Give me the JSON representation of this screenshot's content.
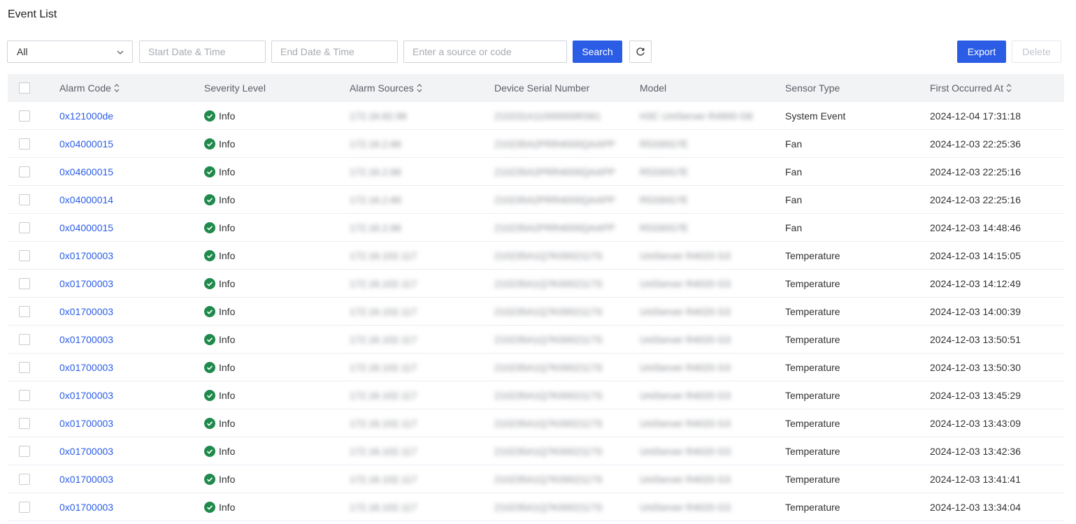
{
  "page": {
    "title": "Event List"
  },
  "toolbar": {
    "select_value": "All",
    "start_placeholder": "Start Date & Time",
    "end_placeholder": "End Date & Time",
    "search_placeholder": "Enter a source or code",
    "search_label": "Search",
    "export_label": "Export",
    "delete_label": "Delete"
  },
  "colors": {
    "accent": "#2b5ce6",
    "info_green": "#1f8a4c"
  },
  "table": {
    "headers": {
      "alarm_code": "Alarm Code",
      "severity": "Severity Level",
      "sources": "Alarm Sources",
      "serial": "Device Serial Number",
      "model": "Model",
      "sensor": "Sensor Type",
      "first": "First Occurred At"
    },
    "rows": [
      {
        "code": "0x121000de",
        "severity": "Info",
        "source": "172.16.62.96",
        "serial": "210231A11000000RS61",
        "model": "H3C UniServer R4900 G6",
        "sensor": "System Event",
        "time": "2024-12-04 17:31:18"
      },
      {
        "code": "0x04000015",
        "severity": "Info",
        "source": "172.16.2.66",
        "serial": "210235A2PRR4000QAAPP",
        "model": "R5330G7E",
        "sensor": "Fan",
        "time": "2024-12-03 22:25:36"
      },
      {
        "code": "0x04600015",
        "severity": "Info",
        "source": "172.16.2.66",
        "serial": "210235A2PRR4000QAAPP",
        "model": "R5330G7E",
        "sensor": "Fan",
        "time": "2024-12-03 22:25:16"
      },
      {
        "code": "0x04000014",
        "severity": "Info",
        "source": "172.16.2.66",
        "serial": "210235A2PRR4000QAAPP",
        "model": "R5330G7E",
        "sensor": "Fan",
        "time": "2024-12-03 22:25:16"
      },
      {
        "code": "0x04000015",
        "severity": "Info",
        "source": "172.16.2.66",
        "serial": "210235A2PRR4000QAAPP",
        "model": "R5330G7E",
        "sensor": "Fan",
        "time": "2024-12-03 14:48:46"
      },
      {
        "code": "0x01700003",
        "severity": "Info",
        "source": "172.16.102.117",
        "serial": "210235A1Q7K0002117S",
        "model": "UniServer R4020 G3",
        "sensor": "Temperature",
        "time": "2024-12-03 14:15:05"
      },
      {
        "code": "0x01700003",
        "severity": "Info",
        "source": "172.16.102.117",
        "serial": "210235A1Q7K0002117S",
        "model": "UniServer R4020 G3",
        "sensor": "Temperature",
        "time": "2024-12-03 14:12:49"
      },
      {
        "code": "0x01700003",
        "severity": "Info",
        "source": "172.16.102.117",
        "serial": "210235A1Q7K0002117S",
        "model": "UniServer R4020 G3",
        "sensor": "Temperature",
        "time": "2024-12-03 14:00:39"
      },
      {
        "code": "0x01700003",
        "severity": "Info",
        "source": "172.16.102.117",
        "serial": "210235A1Q7K0002117S",
        "model": "UniServer R4020 G3",
        "sensor": "Temperature",
        "time": "2024-12-03 13:50:51"
      },
      {
        "code": "0x01700003",
        "severity": "Info",
        "source": "172.16.102.117",
        "serial": "210235A1Q7K0002117S",
        "model": "UniServer R4020 G3",
        "sensor": "Temperature",
        "time": "2024-12-03 13:50:30"
      },
      {
        "code": "0x01700003",
        "severity": "Info",
        "source": "172.16.102.117",
        "serial": "210235A1Q7K0002117S",
        "model": "UniServer R4020 G3",
        "sensor": "Temperature",
        "time": "2024-12-03 13:45:29"
      },
      {
        "code": "0x01700003",
        "severity": "Info",
        "source": "172.16.102.117",
        "serial": "210235A1Q7K0002117S",
        "model": "UniServer R4020 G3",
        "sensor": "Temperature",
        "time": "2024-12-03 13:43:09"
      },
      {
        "code": "0x01700003",
        "severity": "Info",
        "source": "172.16.102.117",
        "serial": "210235A1Q7K0002117S",
        "model": "UniServer R4020 G3",
        "sensor": "Temperature",
        "time": "2024-12-03 13:42:36"
      },
      {
        "code": "0x01700003",
        "severity": "Info",
        "source": "172.16.102.117",
        "serial": "210235A1Q7K0002117S",
        "model": "UniServer R4020 G3",
        "sensor": "Temperature",
        "time": "2024-12-03 13:41:41"
      },
      {
        "code": "0x01700003",
        "severity": "Info",
        "source": "172.16.102.117",
        "serial": "210235A1Q7K0002117S",
        "model": "UniServer R4020 G3",
        "sensor": "Temperature",
        "time": "2024-12-03 13:34:04"
      }
    ]
  }
}
